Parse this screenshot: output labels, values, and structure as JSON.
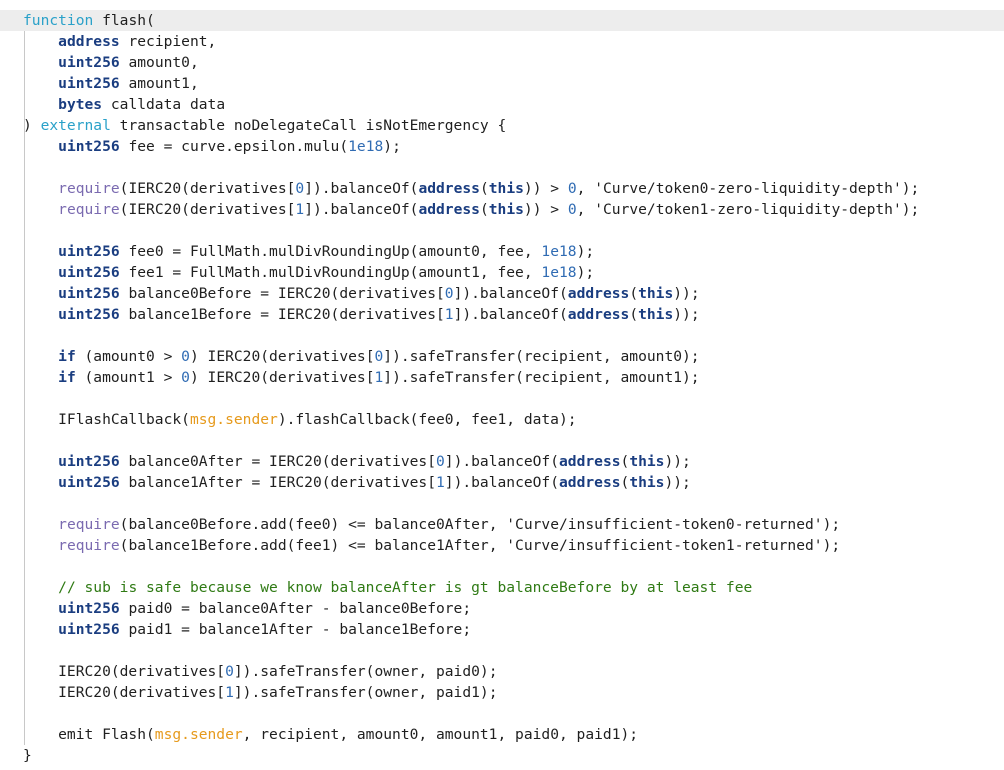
{
  "editor": {
    "lines": [
      [
        {
          "t": "function",
          "c": "kw2"
        },
        {
          "t": " flash(",
          "c": "plain"
        }
      ],
      [
        {
          "t": "    ",
          "c": "plain"
        },
        {
          "t": "address",
          "c": "kw"
        },
        {
          "t": " recipient,",
          "c": "plain"
        }
      ],
      [
        {
          "t": "    ",
          "c": "plain"
        },
        {
          "t": "uint256",
          "c": "kw"
        },
        {
          "t": " amount0,",
          "c": "plain"
        }
      ],
      [
        {
          "t": "    ",
          "c": "plain"
        },
        {
          "t": "uint256",
          "c": "kw"
        },
        {
          "t": " amount1,",
          "c": "plain"
        }
      ],
      [
        {
          "t": "    ",
          "c": "plain"
        },
        {
          "t": "bytes",
          "c": "kw"
        },
        {
          "t": " calldata data",
          "c": "plain"
        }
      ],
      [
        {
          "t": ") ",
          "c": "plain"
        },
        {
          "t": "external",
          "c": "kw2"
        },
        {
          "t": " transactable noDelegateCall isNotEmergency {",
          "c": "plain"
        }
      ],
      [
        {
          "t": "    ",
          "c": "plain"
        },
        {
          "t": "uint256",
          "c": "kw"
        },
        {
          "t": " fee = curve.epsilon.mulu(",
          "c": "plain"
        },
        {
          "t": "1e18",
          "c": "num"
        },
        {
          "t": ");",
          "c": "plain"
        }
      ],
      [],
      [
        {
          "t": "    ",
          "c": "plain"
        },
        {
          "t": "require",
          "c": "fn"
        },
        {
          "t": "(IERC20(derivatives[",
          "c": "plain"
        },
        {
          "t": "0",
          "c": "num"
        },
        {
          "t": "]).balanceOf(",
          "c": "plain"
        },
        {
          "t": "address",
          "c": "kw"
        },
        {
          "t": "(",
          "c": "plain"
        },
        {
          "t": "this",
          "c": "kw"
        },
        {
          "t": ")) > ",
          "c": "plain"
        },
        {
          "t": "0",
          "c": "num"
        },
        {
          "t": ", 'Curve/token0-zero-liquidity-depth');",
          "c": "plain"
        }
      ],
      [
        {
          "t": "    ",
          "c": "plain"
        },
        {
          "t": "require",
          "c": "fn"
        },
        {
          "t": "(IERC20(derivatives[",
          "c": "plain"
        },
        {
          "t": "1",
          "c": "num"
        },
        {
          "t": "]).balanceOf(",
          "c": "plain"
        },
        {
          "t": "address",
          "c": "kw"
        },
        {
          "t": "(",
          "c": "plain"
        },
        {
          "t": "this",
          "c": "kw"
        },
        {
          "t": ")) > ",
          "c": "plain"
        },
        {
          "t": "0",
          "c": "num"
        },
        {
          "t": ", 'Curve/token1-zero-liquidity-depth');",
          "c": "plain"
        }
      ],
      [],
      [
        {
          "t": "    ",
          "c": "plain"
        },
        {
          "t": "uint256",
          "c": "kw"
        },
        {
          "t": " fee0 = FullMath.mulDivRoundingUp(amount0, fee, ",
          "c": "plain"
        },
        {
          "t": "1e18",
          "c": "num"
        },
        {
          "t": ");",
          "c": "plain"
        }
      ],
      [
        {
          "t": "    ",
          "c": "plain"
        },
        {
          "t": "uint256",
          "c": "kw"
        },
        {
          "t": " fee1 = FullMath.mulDivRoundingUp(amount1, fee, ",
          "c": "plain"
        },
        {
          "t": "1e18",
          "c": "num"
        },
        {
          "t": ");",
          "c": "plain"
        }
      ],
      [
        {
          "t": "    ",
          "c": "plain"
        },
        {
          "t": "uint256",
          "c": "kw"
        },
        {
          "t": " balance0Before = IERC20(derivatives[",
          "c": "plain"
        },
        {
          "t": "0",
          "c": "num"
        },
        {
          "t": "]).balanceOf(",
          "c": "plain"
        },
        {
          "t": "address",
          "c": "kw"
        },
        {
          "t": "(",
          "c": "plain"
        },
        {
          "t": "this",
          "c": "kw"
        },
        {
          "t": "));",
          "c": "plain"
        }
      ],
      [
        {
          "t": "    ",
          "c": "plain"
        },
        {
          "t": "uint256",
          "c": "kw"
        },
        {
          "t": " balance1Before = IERC20(derivatives[",
          "c": "plain"
        },
        {
          "t": "1",
          "c": "num"
        },
        {
          "t": "]).balanceOf(",
          "c": "plain"
        },
        {
          "t": "address",
          "c": "kw"
        },
        {
          "t": "(",
          "c": "plain"
        },
        {
          "t": "this",
          "c": "kw"
        },
        {
          "t": "));",
          "c": "plain"
        }
      ],
      [],
      [
        {
          "t": "    ",
          "c": "plain"
        },
        {
          "t": "if",
          "c": "kw"
        },
        {
          "t": " (amount0 > ",
          "c": "plain"
        },
        {
          "t": "0",
          "c": "num"
        },
        {
          "t": ") IERC20(derivatives[",
          "c": "plain"
        },
        {
          "t": "0",
          "c": "num"
        },
        {
          "t": "]).safeTransfer(recipient, amount0);",
          "c": "plain"
        }
      ],
      [
        {
          "t": "    ",
          "c": "plain"
        },
        {
          "t": "if",
          "c": "kw"
        },
        {
          "t": " (amount1 > ",
          "c": "plain"
        },
        {
          "t": "0",
          "c": "num"
        },
        {
          "t": ") IERC20(derivatives[",
          "c": "plain"
        },
        {
          "t": "1",
          "c": "num"
        },
        {
          "t": "]).safeTransfer(recipient, amount1);",
          "c": "plain"
        }
      ],
      [],
      [
        {
          "t": "    IFlashCallback(",
          "c": "plain"
        },
        {
          "t": "msg.sender",
          "c": "msg"
        },
        {
          "t": ").flashCallback(fee0, fee1, data);",
          "c": "plain"
        }
      ],
      [],
      [
        {
          "t": "    ",
          "c": "plain"
        },
        {
          "t": "uint256",
          "c": "kw"
        },
        {
          "t": " balance0After = IERC20(derivatives[",
          "c": "plain"
        },
        {
          "t": "0",
          "c": "num"
        },
        {
          "t": "]).balanceOf(",
          "c": "plain"
        },
        {
          "t": "address",
          "c": "kw"
        },
        {
          "t": "(",
          "c": "plain"
        },
        {
          "t": "this",
          "c": "kw"
        },
        {
          "t": "));",
          "c": "plain"
        }
      ],
      [
        {
          "t": "    ",
          "c": "plain"
        },
        {
          "t": "uint256",
          "c": "kw"
        },
        {
          "t": " balance1After = IERC20(derivatives[",
          "c": "plain"
        },
        {
          "t": "1",
          "c": "num"
        },
        {
          "t": "]).balanceOf(",
          "c": "plain"
        },
        {
          "t": "address",
          "c": "kw"
        },
        {
          "t": "(",
          "c": "plain"
        },
        {
          "t": "this",
          "c": "kw"
        },
        {
          "t": "));",
          "c": "plain"
        }
      ],
      [],
      [
        {
          "t": "    ",
          "c": "plain"
        },
        {
          "t": "require",
          "c": "fn"
        },
        {
          "t": "(balance0Before.add(fee0) <= balance0After, 'Curve/insufficient-token0-returned');",
          "c": "plain"
        }
      ],
      [
        {
          "t": "    ",
          "c": "plain"
        },
        {
          "t": "require",
          "c": "fn"
        },
        {
          "t": "(balance1Before.add(fee1) <= balance1After, 'Curve/insufficient-token1-returned');",
          "c": "plain"
        }
      ],
      [],
      [
        {
          "t": "    ",
          "c": "plain"
        },
        {
          "t": "// sub is safe because we know balanceAfter is gt balanceBefore by at least fee",
          "c": "cmt"
        }
      ],
      [
        {
          "t": "    ",
          "c": "plain"
        },
        {
          "t": "uint256",
          "c": "kw"
        },
        {
          "t": " paid0 = balance0After - balance0Before;",
          "c": "plain"
        }
      ],
      [
        {
          "t": "    ",
          "c": "plain"
        },
        {
          "t": "uint256",
          "c": "kw"
        },
        {
          "t": " paid1 = balance1After - balance1Before;",
          "c": "plain"
        }
      ],
      [],
      [
        {
          "t": "    IERC20(derivatives[",
          "c": "plain"
        },
        {
          "t": "0",
          "c": "num"
        },
        {
          "t": "]).safeTransfer(owner, paid0);",
          "c": "plain"
        }
      ],
      [
        {
          "t": "    IERC20(derivatives[",
          "c": "plain"
        },
        {
          "t": "1",
          "c": "num"
        },
        {
          "t": "]).safeTransfer(owner, paid1);",
          "c": "plain"
        }
      ],
      [],
      [
        {
          "t": "    emit Flash(",
          "c": "plain"
        },
        {
          "t": "msg.sender",
          "c": "msg"
        },
        {
          "t": ", recipient, amount0, amount1, paid0, paid1);",
          "c": "plain"
        }
      ],
      [
        {
          "t": "}",
          "c": "plain"
        }
      ]
    ],
    "colors": {
      "keyword": "#1a3d80",
      "keyword_light": "#2aa1c9",
      "require": "#7a6ab0",
      "number": "#2f6bb3",
      "msg_sender": "#e69a1c",
      "comment": "#2f7a14",
      "current_line": "#ededed"
    }
  }
}
